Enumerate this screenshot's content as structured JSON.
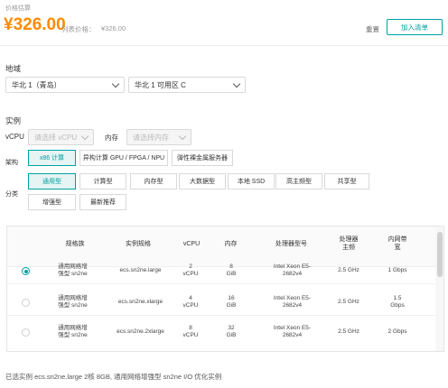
{
  "price": {
    "label": "价格估算",
    "amount": "¥326.00",
    "list_label": "列表价格：",
    "list_value": "¥326.00",
    "reset": "重置",
    "add_to_list": "加入清单"
  },
  "region": {
    "label": "地域",
    "region_value": "华北 1（青岛）",
    "zone_value": "华北 1 可用区 C"
  },
  "instance": {
    "label": "实例",
    "vcpu_label": "vCPU",
    "vcpu_placeholder": "请选择 vCPU",
    "memory_label": "内存",
    "memory_placeholder": "请选择内存",
    "arch_label": "架构",
    "arch_options": [
      "x86 计算",
      "异构计算 GPU / FPGA / NPU",
      "弹性裸金属服务器"
    ],
    "category_label": "分类",
    "category_row1": [
      "通用型",
      "计算型",
      "内存型",
      "大数据型",
      "本地 SSD",
      "高主频型",
      "共享型"
    ],
    "category_row2": [
      "增强型",
      "最新推荐"
    ]
  },
  "table": {
    "headers": [
      "规格族",
      "实例规格",
      "vCPU",
      "内存",
      "处理器型号",
      "处理器\n主频",
      "内网带\n宽"
    ],
    "rows": [
      {
        "family": "通用网络增\n强型 sn2ne",
        "spec": "ecs.sn2ne.large",
        "vcpu": "2\nvCPU",
        "mem": "8\nGiB",
        "cpu": "Intel Xeon E5-\n2682v4",
        "freq": "2.5 GHz",
        "bw": "1 Gbps",
        "selected": true
      },
      {
        "family": "通用网络增\n强型 sn2ne",
        "spec": "ecs.sn2ne.xlarge",
        "vcpu": "4\nvCPU",
        "mem": "16\nGiB",
        "cpu": "Intel Xeon E5-\n2682v4",
        "freq": "2.5 GHz",
        "bw": "1.5\nGbps",
        "selected": false
      },
      {
        "family": "通用网络增\n强型 sn2ne",
        "spec": "ecs.sn2ne.2xlarge",
        "vcpu": "8\nvCPU",
        "mem": "32\nGiB",
        "cpu": "Intel Xeon E5-\n2682v4",
        "freq": "2.5 GHz",
        "bw": "2 Gbps",
        "selected": false
      }
    ]
  },
  "summary": "已选实例 ecs.sn2ne.large 2核 8GB, 通用网络增强型 sn2ne I/O 优化实例",
  "colors": {
    "accent": "#00a1a1",
    "price": "#ff8a00"
  }
}
